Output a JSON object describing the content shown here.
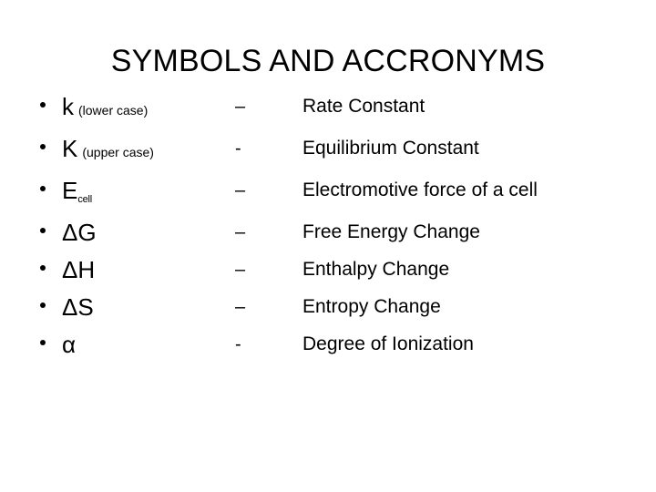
{
  "slide": {
    "title": "SYMBOLS AND ACCRONYMS",
    "background_color": "#ffffff",
    "text_color": "#000000",
    "bullet_glyph": "•"
  },
  "rows": [
    {
      "symbol": "k",
      "note": "(lower case)",
      "subscript": "",
      "separator": "–",
      "definition": "Rate Constant"
    },
    {
      "symbol": "K",
      "note": "(upper case)",
      "subscript": "",
      "separator": "-",
      "definition": "Equilibrium Constant"
    },
    {
      "symbol": "E",
      "note": "",
      "subscript": "cell",
      "separator": "–",
      "definition": "Electromotive force of a cell"
    },
    {
      "symbol": "ΔG",
      "note": "",
      "subscript": "",
      "separator": "–",
      "definition": "Free Energy Change"
    },
    {
      "symbol": "ΔH",
      "note": "",
      "subscript": "",
      "separator": "–",
      "definition": "Enthalpy Change"
    },
    {
      "symbol": "ΔS",
      "note": "",
      "subscript": "",
      "separator": "–",
      "definition": "Entropy Change"
    },
    {
      "symbol": "α",
      "note": "",
      "subscript": "",
      "separator": "-",
      "definition": "Degree of Ionization"
    }
  ]
}
